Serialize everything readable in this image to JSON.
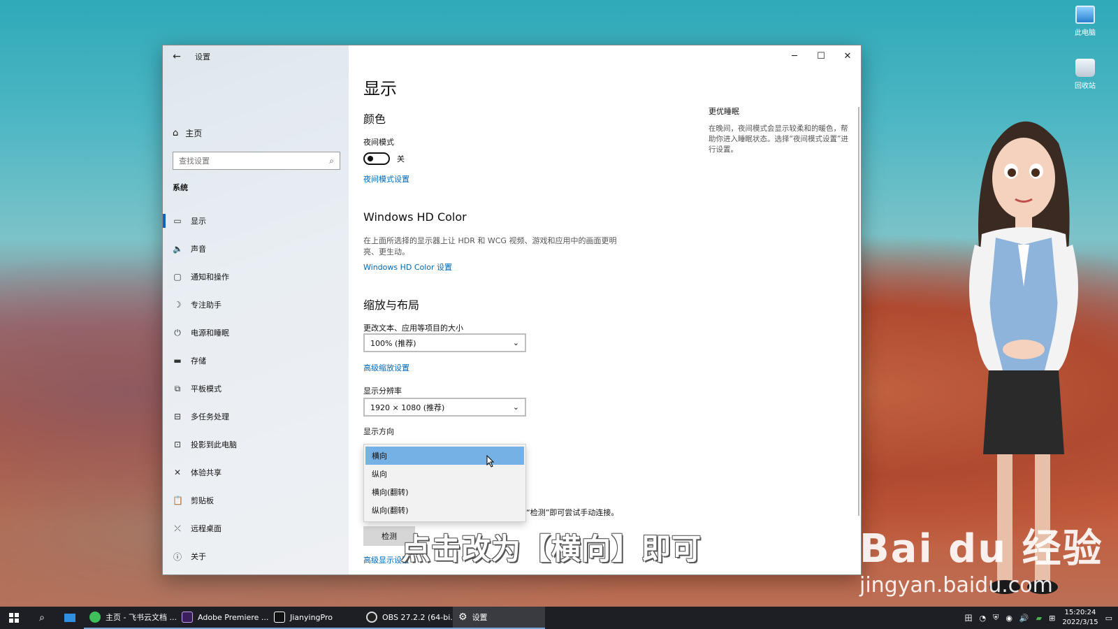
{
  "desktop": {
    "icons": [
      {
        "label": "此电脑"
      },
      {
        "label": "回收站"
      }
    ]
  },
  "window": {
    "title": "设置",
    "back_glyph": "←",
    "controls": {
      "minimize": "─",
      "maximize": "☐",
      "close": "✕"
    }
  },
  "sidebar": {
    "home_label": "主页",
    "search_placeholder": "查找设置",
    "section_label": "系统",
    "items": [
      {
        "label": "显示",
        "icon": "monitor-icon",
        "glyph": "▭"
      },
      {
        "label": "声音",
        "icon": "speaker-icon",
        "glyph": "🔈"
      },
      {
        "label": "通知和操作",
        "icon": "message-icon",
        "glyph": "▢"
      },
      {
        "label": "专注助手",
        "icon": "moon-icon",
        "glyph": "☽"
      },
      {
        "label": "电源和睡眠",
        "icon": "power-icon",
        "glyph": "⏻"
      },
      {
        "label": "存储",
        "icon": "storage-icon",
        "glyph": "▬"
      },
      {
        "label": "平板模式",
        "icon": "tablet-icon",
        "glyph": "⧉"
      },
      {
        "label": "多任务处理",
        "icon": "multitask-icon",
        "glyph": "⊟"
      },
      {
        "label": "投影到此电脑",
        "icon": "project-icon",
        "glyph": "⊡"
      },
      {
        "label": "体验共享",
        "icon": "share-icon",
        "glyph": "✕"
      },
      {
        "label": "剪贴板",
        "icon": "clipboard-icon",
        "glyph": "📋"
      },
      {
        "label": "远程桌面",
        "icon": "remote-icon",
        "glyph": "⤫"
      },
      {
        "label": "关于",
        "icon": "info-icon",
        "glyph": "ⓘ"
      }
    ]
  },
  "main": {
    "title": "显示",
    "color": {
      "heading": "颜色",
      "night_mode_label": "夜间模式",
      "night_mode_state": "关",
      "night_mode_link": "夜间模式设置"
    },
    "hdr": {
      "heading": "Windows HD Color",
      "desc": "在上面所选择的显示器上让 HDR 和 WCG 视频、游戏和应用中的画面更明亮、更生动。",
      "link": "Windows HD Color 设置"
    },
    "scale": {
      "heading": "缩放与布局",
      "size_label": "更改文本、应用等项目的大小",
      "size_value": "100% (推荐)",
      "advanced_link": "高级缩放设置",
      "resolution_label": "显示分辨率",
      "resolution_value": "1920 × 1080 (推荐)",
      "orientation_label": "显示方向",
      "orientation_options": [
        "横向",
        "纵向",
        "横向(翻转)",
        "纵向(翻转)"
      ]
    },
    "partial_text": "“检测”即可尝试手动连接。",
    "detect_button": "检测",
    "advanced_display_link": "高级显示设置"
  },
  "right_panel": {
    "title": "更优睡眠",
    "desc": "在晚间，夜间模式会显示较柔和的暖色，帮助你进入睡眠状态。选择“夜间模式设置”进行设置。"
  },
  "caption": "点击改为【横向】即可",
  "watermark": {
    "logo": "Bai du 经验",
    "url": "jingyan.baidu.com"
  },
  "taskbar": {
    "apps": [
      {
        "label": "主页 - 飞书云文档 ...",
        "color": "#3fbf5a"
      },
      {
        "label": "Adobe Premiere ...",
        "color": "#3b1f5c"
      },
      {
        "label": "JianyingPro",
        "color": "#111111"
      },
      {
        "label": "OBS 27.2.2 (64-bi...",
        "color": "#222222"
      },
      {
        "label": "设置",
        "color": "#3a3b41"
      }
    ],
    "time": "15:20:24",
    "date": "2022/3/15"
  }
}
